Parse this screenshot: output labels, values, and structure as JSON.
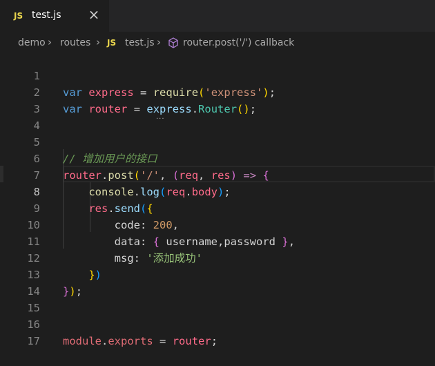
{
  "tab": {
    "label": "test.js",
    "badge": "JS",
    "close": "×"
  },
  "breadcrumb": {
    "items": [
      "demo",
      "routes",
      "test.js",
      "router.post('/') callback"
    ],
    "js_badge": "JS"
  },
  "editor": {
    "line_numbers": [
      "1",
      "2",
      "3",
      "4",
      "5",
      "6",
      "7",
      "8",
      "9",
      "10",
      "11",
      "12",
      "13",
      "14",
      "15",
      "16",
      "17"
    ],
    "comment": "// 增加用户的接口",
    "msg_value": "'添加成功'",
    "code_value": "200"
  },
  "colors": {
    "background": "#1e1e1e",
    "tabbar": "#252526",
    "accent": "#e8d44d"
  }
}
